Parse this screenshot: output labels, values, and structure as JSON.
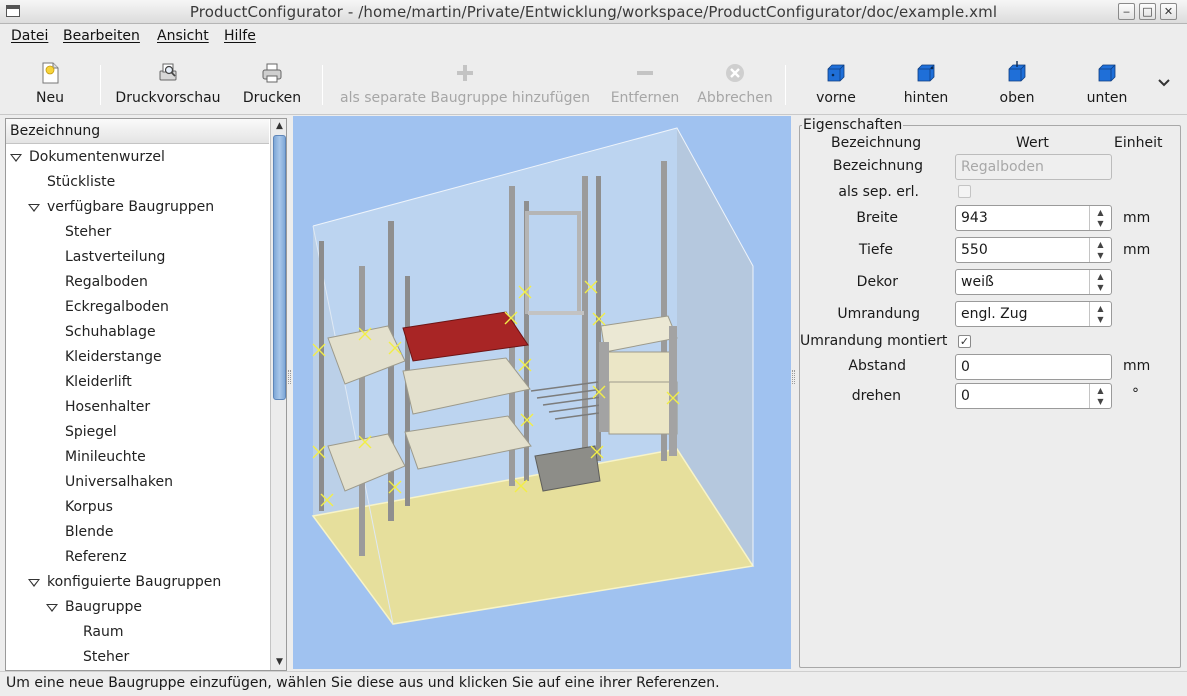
{
  "window": {
    "title": "ProductConfigurator - /home/martin/Private/Entwicklung/workspace/ProductConfigurator/doc/example.xml",
    "buttons": {
      "minimize": "‒",
      "maximize": "□",
      "close": "✕"
    }
  },
  "menu": [
    "Datei",
    "Bearbeiten",
    "Ansicht",
    "Hilfe"
  ],
  "toolbar": {
    "new": "Neu",
    "print_preview": "Druckvorschau",
    "print": "Drucken",
    "add_separate": "als separate Baugruppe hinzufügen",
    "remove": "Entfernen",
    "cancel": "Abbrechen",
    "front": "vorne",
    "back": "hinten",
    "top": "oben",
    "bottom": "unten",
    "overflow": "⌄"
  },
  "tree": {
    "header": "Bezeichnung",
    "items": [
      "Dokumentenwurzel",
      "Stückliste",
      "verfügbare Baugruppen",
      "Steher",
      "Lastverteilung",
      "Regalboden",
      "Eckregalboden",
      "Schuhablage",
      "Kleiderstange",
      "Kleiderlift",
      "Hosenhalter",
      "Spiegel",
      "Minileuchte",
      "Universalhaken",
      "Korpus",
      "Blende",
      "Referenz",
      "konfiguierte Baugruppen",
      "Baugruppe",
      "Raum",
      "Steher"
    ]
  },
  "properties": {
    "legend": "Eigenschaften",
    "headers": {
      "name": "Bezeichnung",
      "value": "Wert",
      "unit": "Einheit"
    },
    "rows": [
      {
        "label": "Bezeichnung",
        "value": "Regalboden",
        "unit": ""
      },
      {
        "label": "als sep. erl.",
        "value": "",
        "unit": ""
      },
      {
        "label": "Breite",
        "value": "943",
        "unit": "mm"
      },
      {
        "label": "Tiefe",
        "value": "550",
        "unit": "mm"
      },
      {
        "label": "Dekor",
        "value": "weiß",
        "unit": ""
      },
      {
        "label": "Umrandung",
        "value": "engl. Zug",
        "unit": ""
      },
      {
        "label": "Umrandung montiert",
        "value": "✓",
        "unit": ""
      },
      {
        "label": "Abstand",
        "value": "0",
        "unit": "mm"
      },
      {
        "label": "drehen",
        "value": "0",
        "unit": "°"
      }
    ]
  },
  "status": "Um eine neue Baugruppe einzufügen, wählen Sie diese aus und klicken Sie auf eine ihrer Referenzen.",
  "colors": {
    "viewport_bg": "#a0c2f0",
    "floor": "#e6df9c",
    "selected_shelf": "#a82525",
    "cube_icon": "#1f6fd8",
    "scroll_thumb": "#7ea7d7"
  },
  "icons": {
    "new": "new-document-icon",
    "print_preview": "print-preview-icon",
    "print": "printer-icon",
    "add": "plus-icon",
    "remove": "minus-icon",
    "cancel": "cancel-icon",
    "view": "cube-view-icon"
  }
}
